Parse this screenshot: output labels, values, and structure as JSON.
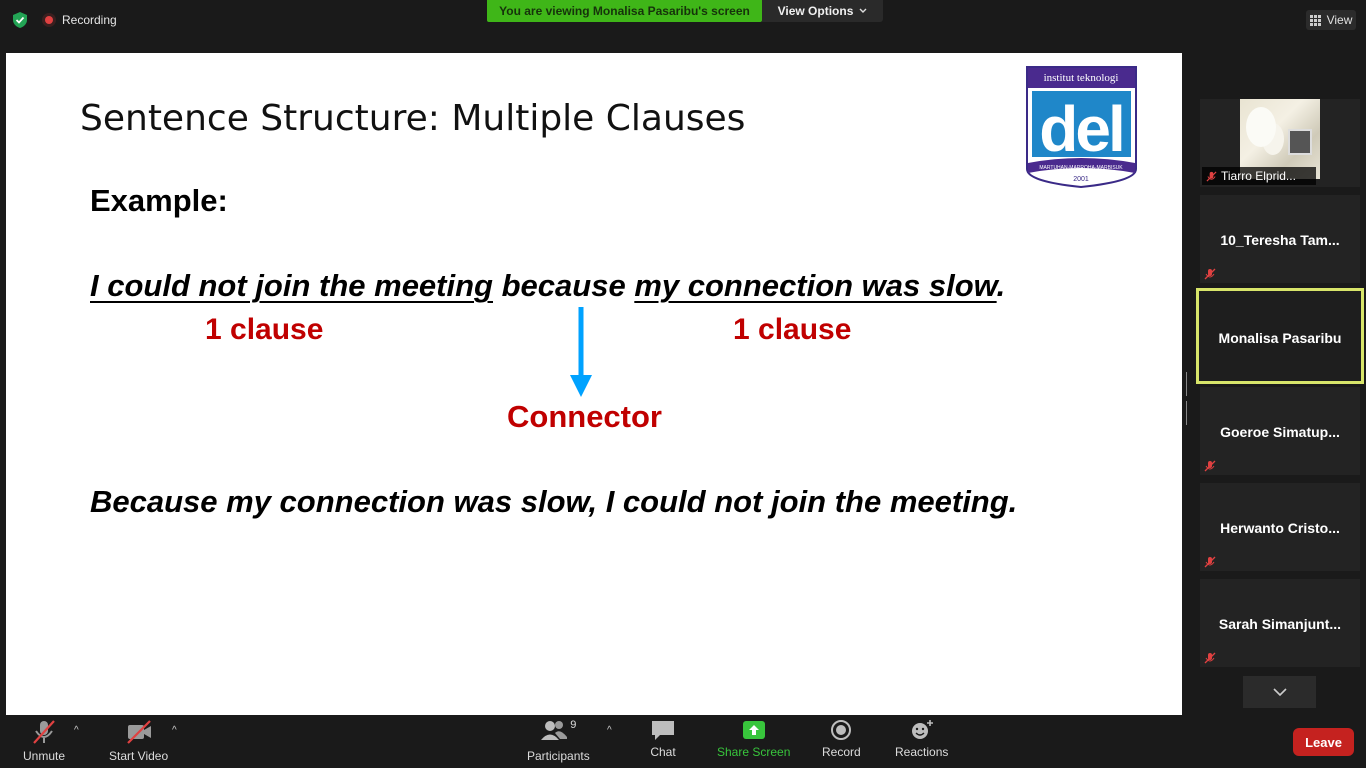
{
  "top": {
    "recording_label": "Recording",
    "viewing_banner": "You are viewing Monalisa Pasaribu's screen",
    "view_options_label": "View Options",
    "view_label": "View"
  },
  "slide": {
    "title": "Sentence Structure: Multiple Clauses",
    "example_label": "Example:",
    "sentence_part1": "I could not join the meeting",
    "sentence_connector": " because ",
    "sentence_part2": "my connection was slow",
    "sentence_end": ".",
    "clause_label_1": "1 clause",
    "clause_label_2": "1 clause",
    "connector_label": "Connector",
    "sentence2": "Because my connection was slow, I could not join the meeting.",
    "logo_top_text": "institut teknologi",
    "logo_word": "del",
    "logo_motto": "MARTUHAN·MARROHA·MARBISUK",
    "logo_year": "2001"
  },
  "gallery": {
    "participants": [
      {
        "name": "Tiarro Elprid...",
        "muted": true,
        "has_video": true
      },
      {
        "name": "10_Teresha Tam...",
        "muted": true
      },
      {
        "name": "Monalisa Pasaribu",
        "muted": false,
        "active_speaker": true
      },
      {
        "name": "Goeroe  Simatup...",
        "muted": true
      },
      {
        "name": "Herwanto  Cristo...",
        "muted": true
      },
      {
        "name": "Sarah  Simanjunt...",
        "muted": true
      }
    ]
  },
  "toolbar": {
    "unmute_label": "Unmute",
    "start_video_label": "Start Video",
    "participants_label": "Participants",
    "participants_count": "9",
    "chat_label": "Chat",
    "share_screen_label": "Share Screen",
    "record_label": "Record",
    "reactions_label": "Reactions",
    "leave_label": "Leave"
  },
  "colors": {
    "viewing_banner": "#3fb618",
    "share_screen": "#38c53c",
    "leave": "#c5221f",
    "active_speaker_border": "#d8e56a",
    "slide_red": "#c00000",
    "arrow_blue": "#00a2ff"
  }
}
